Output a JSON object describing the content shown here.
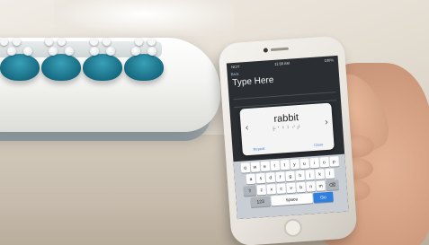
{
  "phone_screen": {
    "status_left": "NCIT",
    "status_time": "11:58 AM",
    "status_right": "100%",
    "back_label": "Back",
    "title": "Type Here",
    "modal": {
      "word": "rabbit",
      "braille": "⠗⠁⠃⠃⠊⠞",
      "left_arrow": "‹",
      "right_arrow": "›",
      "left_button": "Repeat",
      "right_button": "Close"
    },
    "keyboard": {
      "row1": [
        "q",
        "w",
        "e",
        "r",
        "t",
        "y",
        "u",
        "i",
        "o",
        "p"
      ],
      "row2": [
        "a",
        "s",
        "d",
        "f",
        "g",
        "h",
        "j",
        "k",
        "l"
      ],
      "row3": [
        "⇧",
        "z",
        "x",
        "c",
        "v",
        "b",
        "n",
        "m",
        "⌫"
      ],
      "num_label": "123",
      "space_label": "space",
      "go_label": "Go"
    }
  },
  "colors": {
    "key_teal": "#176b82",
    "screen_bg": "#2b2f33",
    "go_key": "#2f7fe0"
  }
}
